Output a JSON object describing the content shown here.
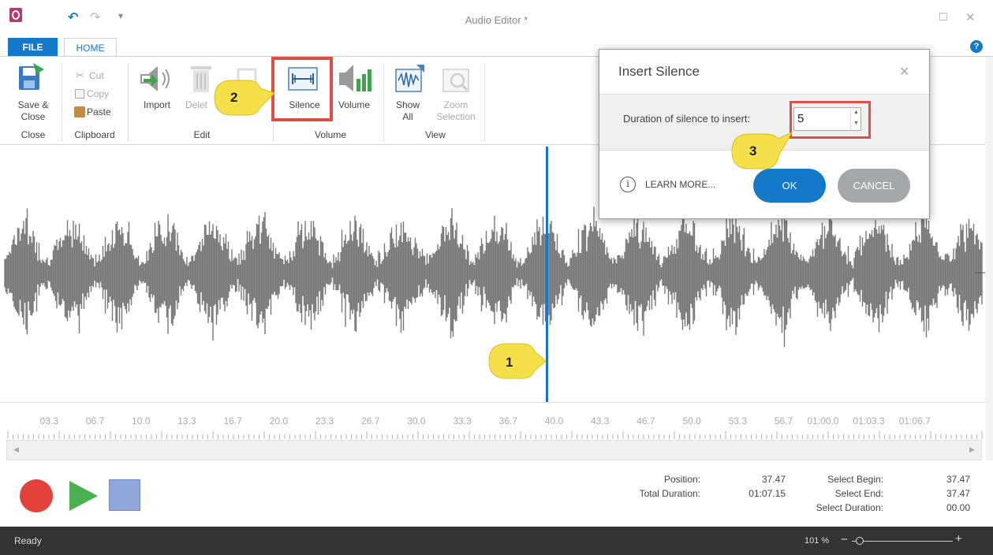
{
  "app": {
    "title": "Audio Editor *",
    "undo_icon": "undo-icon",
    "redo_icon": "redo-icon"
  },
  "tabs": {
    "file": "FILE",
    "home": "HOME"
  },
  "ribbon": {
    "save_close": [
      "Save &",
      "Close"
    ],
    "cut": "Cut",
    "copy": "Copy",
    "paste": "Paste",
    "import": "Import",
    "delete": "Delet",
    "silence": "Silence",
    "volume": "Volume",
    "show_all": [
      "Show",
      "All"
    ],
    "zoom_selection": [
      "Zoom",
      "Selection"
    ],
    "groups": {
      "close": "Close",
      "clipboard": "Clipboard",
      "edit": "Edit",
      "volume": "Volume",
      "view": "View"
    }
  },
  "timeline": {
    "ticks": [
      "03.3",
      "06.7",
      "10.0",
      "13.3",
      "16.7",
      "20.0",
      "23.3",
      "26.7",
      "30.0",
      "33.3",
      "36.7",
      "40.0",
      "43.3",
      "46.7",
      "50.0",
      "53.3",
      "56.7",
      "01:00.0",
      "01:03.3",
      "01:06.7"
    ]
  },
  "stats": {
    "position_label": "Position:",
    "position_value": "37.47",
    "total_duration_label": "Total Duration:",
    "total_duration_value": "01:07.15",
    "select_begin_label": "Select Begin:",
    "select_begin_value": "37.47",
    "select_end_label": "Select End:",
    "select_end_value": "37.47",
    "select_duration_label": "Select Duration:",
    "select_duration_value": "00.00"
  },
  "status": {
    "text": "Ready",
    "zoom": "101 %"
  },
  "dialog": {
    "title": "Insert Silence",
    "label": "Duration of silence to insert:",
    "value": "5",
    "learn_more": "LEARN MORE...",
    "ok": "OK",
    "cancel": "CANCEL"
  },
  "callouts": [
    "1",
    "2",
    "3"
  ],
  "colors": {
    "accent": "#1479c9",
    "highlight": "#de4e44",
    "callout": "#f6e04a",
    "wave": "#767676"
  }
}
